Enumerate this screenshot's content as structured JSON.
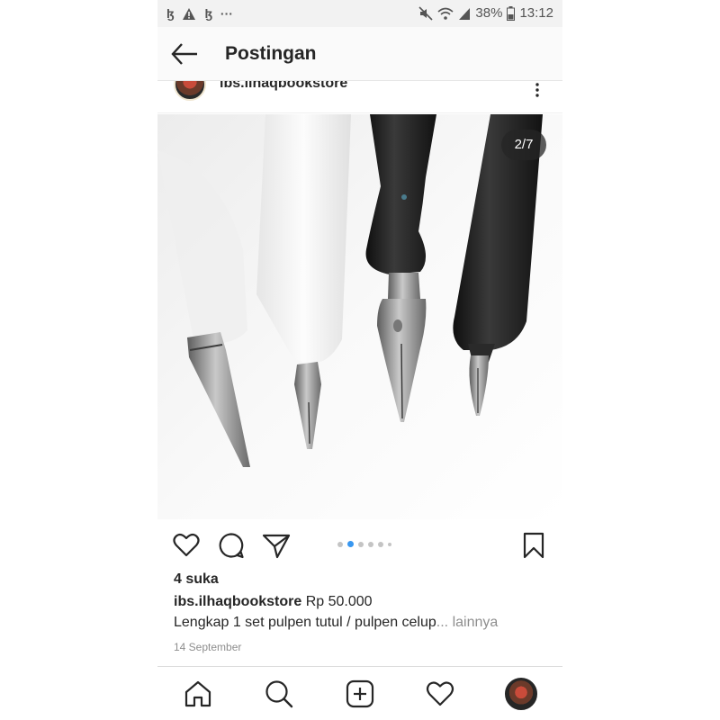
{
  "status_bar": {
    "left_icons": [
      "notification-app-icon",
      "warning-icon",
      "notification-app-icon",
      "more-notifications-icon"
    ],
    "battery": "38%",
    "time": "13:12"
  },
  "header": {
    "title": "Postingan"
  },
  "author": {
    "username": "ibs.ilhaqbookstore"
  },
  "photo": {
    "counter": "2/7"
  },
  "actions": {
    "carousel_total": 6,
    "carousel_active": 2
  },
  "post": {
    "likes": "4 suka",
    "caption_user": "ibs.ilhaqbookstore",
    "caption_price": "Rp 50.000",
    "caption_text": "Lengkap 1 set pulpen tutul / pulpen celup",
    "more_label": "... lainnya",
    "date": "14 September"
  },
  "colors": {
    "accent": "#3897f0",
    "text": "#262626",
    "muted": "#8e8e8e"
  }
}
